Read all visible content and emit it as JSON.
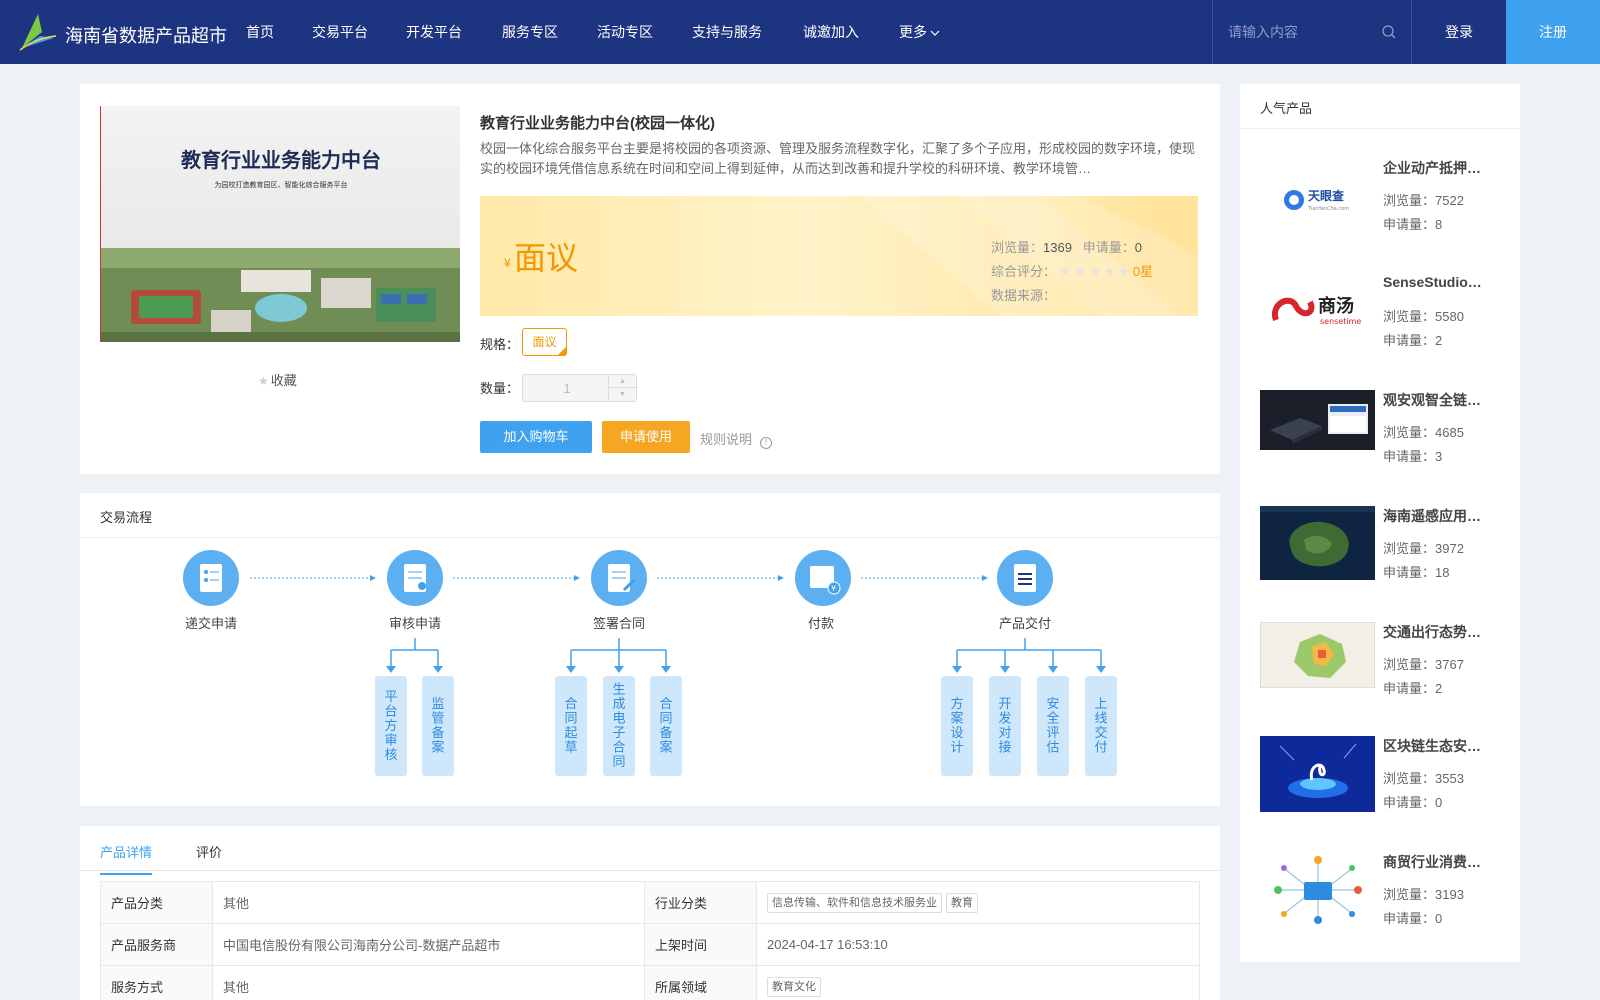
{
  "header": {
    "site_title": "海南省数据产品超市",
    "nav": [
      "首页",
      "交易平台",
      "开发平台",
      "服务专区",
      "活动专区",
      "支持与服务",
      "诚邀加入",
      "更多"
    ],
    "search_placeholder": "请输入内容",
    "login": "登录",
    "register": "注册",
    "colors": {
      "bar": "#1d3580",
      "accent": "#3fa2f0"
    }
  },
  "product": {
    "image_title": "教育行业业务能力中台",
    "image_subtitle": "为园校打造教育园区、智能化综合服务平台",
    "favorite": "收藏",
    "title": "教育行业业务能力中台(校园一体化)",
    "description": "校园一体化综合服务平台主要是将校园的各项资源、管理及服务流程数字化，汇聚了多个子应用，形成校园的数字环境，使现实的校园环境凭借信息系统在时间和空间上得到延伸，从而达到改善和提升学校的科研环境、教学环境管…",
    "price_symbol": "¥",
    "price": "面议",
    "views_label": "浏览量：",
    "views": "1369",
    "applications_label": "申请量：",
    "applications": "0",
    "rating_label": "综合评分：",
    "rating_stars": "★★★★★",
    "rating": "0星",
    "rating_value": 0,
    "source_label": "数据来源：",
    "spec_label": "规格：",
    "spec_option": "面议",
    "quantity_label": "数量：",
    "quantity_value": "1",
    "add_to_cart": "加入购物车",
    "apply_use": "申请使用",
    "rule_note": "规则说明",
    "accent_color": "#f39800"
  },
  "process": {
    "title": "交易流程",
    "steps": [
      "递交申请",
      "审核申请",
      "签署合同",
      "付款",
      "产品交付"
    ],
    "substeps": {
      "审核申请": [
        "平台方审核",
        "监管备案"
      ],
      "签署合同": [
        "合同起草",
        "生成电子合同",
        "合同备案"
      ],
      "产品交付": [
        "方案设计",
        "开发对接",
        "安全评估",
        "上线交付"
      ]
    }
  },
  "details": {
    "tabs": [
      "产品详情",
      "评价"
    ],
    "rows": [
      {
        "k1": "产品分类",
        "v1": "其他",
        "k2": "行业分类",
        "v2_tags": [
          "信息传输、软件和信息技术服务业",
          "教育"
        ]
      },
      {
        "k1": "产品服务商",
        "v1": "中国电信股份有限公司海南分公司-数据产品超市",
        "k2": "上架时间",
        "v2": "2024-04-17 16:53:10"
      },
      {
        "k1": "服务方式",
        "v1": "其他",
        "k2": "所属领域",
        "v2_tags": [
          "教育文化"
        ]
      }
    ]
  },
  "sidebar": {
    "title": "人气产品",
    "items": [
      {
        "name": "企业动产抵押…",
        "views": "浏览量：7522",
        "apps": "申请量：8",
        "thumb": "tianyancha-logo"
      },
      {
        "name": "SenseStudio…",
        "views": "浏览量：5580",
        "apps": "申请量：2",
        "thumb": "sensetime-logo"
      },
      {
        "name": "观安观智全链…",
        "views": "浏览量：4685",
        "apps": "申请量：3",
        "thumb": "device-photo"
      },
      {
        "name": "海南遥感应用…",
        "views": "浏览量：3972",
        "apps": "申请量：18",
        "thumb": "satellite-map"
      },
      {
        "name": "交通出行态势…",
        "views": "浏览量：3767",
        "apps": "申请量：2",
        "thumb": "region-map"
      },
      {
        "name": "区块链生态安…",
        "views": "浏览量：3553",
        "apps": "申请量：0",
        "thumb": "blockchain-art"
      },
      {
        "name": "商贸行业消费…",
        "views": "浏览量：3193",
        "apps": "申请量：0",
        "thumb": "network-art"
      }
    ]
  }
}
